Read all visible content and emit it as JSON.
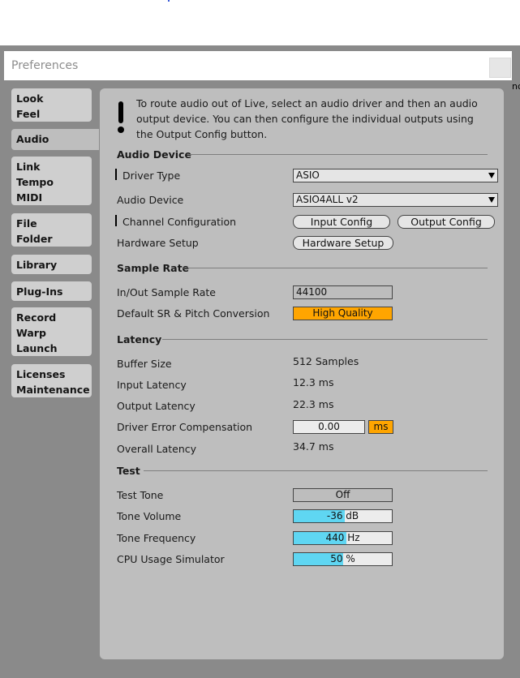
{
  "window": {
    "title": "Preferences",
    "edge_text": "nc"
  },
  "sidebar": {
    "items": [
      {
        "lines": [
          "Look",
          "Feel"
        ]
      },
      {
        "lines": [
          "Audio"
        ]
      },
      {
        "lines": [
          "Link",
          "Tempo",
          "MIDI"
        ]
      },
      {
        "lines": [
          "File",
          "Folder"
        ]
      },
      {
        "lines": [
          "Library"
        ]
      },
      {
        "lines": [
          "Plug-Ins"
        ]
      },
      {
        "lines": [
          "Record",
          "Warp",
          "Launch"
        ]
      },
      {
        "lines": [
          "Licenses",
          "Maintenance"
        ]
      }
    ],
    "active_index": 1
  },
  "info": {
    "text": "To route audio out of Live, select an audio driver and then an audio output device. You can then configure the individual outputs using the Output Config button."
  },
  "audio_device": {
    "header": "Audio Device",
    "driver_type_label": "Driver Type",
    "driver_type_value": "ASIO",
    "audio_device_label": "Audio Device",
    "audio_device_value": "ASIO4ALL v2",
    "channel_config_label": "Channel Configuration",
    "input_config_button": "Input Config",
    "output_config_button": "Output Config",
    "hardware_setup_label": "Hardware Setup",
    "hardware_setup_button": "Hardware Setup"
  },
  "sample_rate": {
    "header": "Sample Rate",
    "inout_label": "In/Out Sample Rate",
    "inout_value": "44100",
    "default_sr_label": "Default SR & Pitch Conversion",
    "default_sr_value": "High Quality"
  },
  "latency": {
    "header": "Latency",
    "buffer_size_label": "Buffer Size",
    "buffer_size_value": "512 Samples",
    "input_latency_label": "Input Latency",
    "input_latency_value": "12.3 ms",
    "output_latency_label": "Output Latency",
    "output_latency_value": "22.3 ms",
    "driver_error_label": "Driver Error Compensation",
    "driver_error_value": "0.00",
    "driver_error_unit": "ms",
    "overall_latency_label": "Overall Latency",
    "overall_latency_value": "34.7 ms"
  },
  "test": {
    "header": "Test",
    "test_tone_label": "Test Tone",
    "test_tone_value": "Off",
    "tone_volume_label": "Tone Volume",
    "tone_volume_value": "-36 dB",
    "tone_volume_level": 0.52,
    "tone_frequency_label": "Tone Frequency",
    "tone_frequency_value": "440 Hz",
    "tone_frequency_level": 0.54,
    "cpu_sim_label": "CPU Usage Simulator",
    "cpu_sim_value": "50 %",
    "cpu_sim_level": 0.5
  },
  "colors": {
    "accent_orange": "#ffa500",
    "slider_fill": "#5fd6f2",
    "panel": "#bebebe",
    "background": "#8a8a8a"
  }
}
